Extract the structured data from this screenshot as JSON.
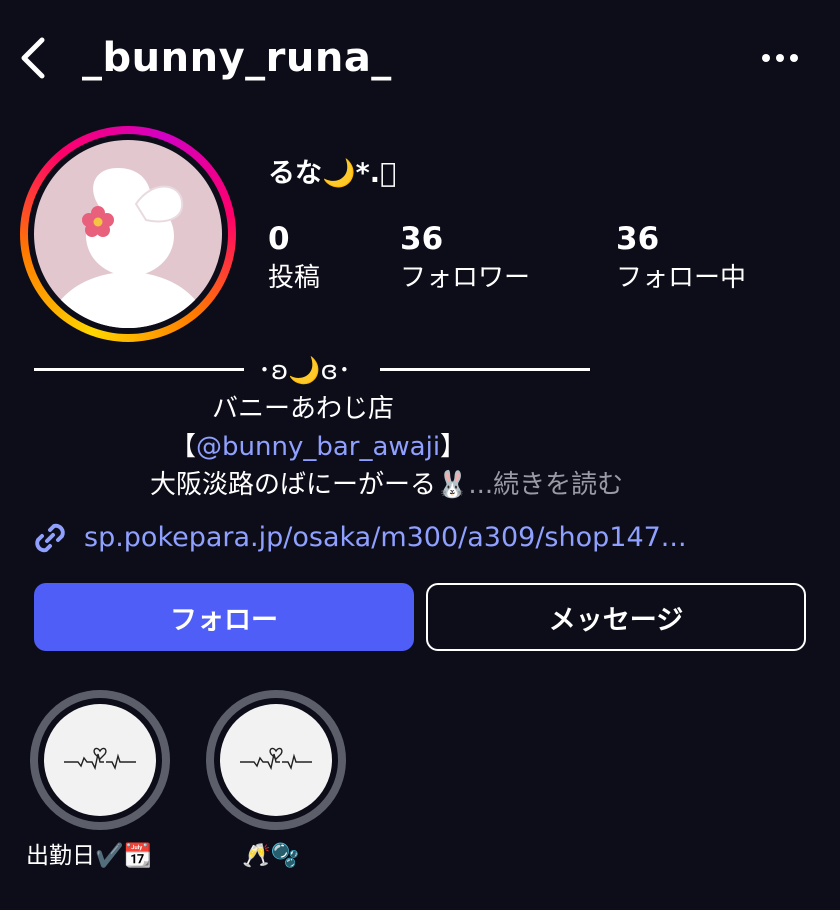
{
  "header": {
    "username": "_bunny_runa_",
    "back_icon": "chevron-left-icon",
    "more_icon": "more-horizontal-icon"
  },
  "profile": {
    "display_name": "るな🌙*.ﾟ",
    "avatar_icon": "bunny-avatar",
    "stats": [
      {
        "value": "0",
        "label": "投稿"
      },
      {
        "value": "36",
        "label": "フォロワー"
      },
      {
        "value": "36",
        "label": "フォロー中"
      }
    ]
  },
  "bio": {
    "divider": "･ʚ🌙ɞ･",
    "line1": "バニーあわじ店",
    "line2_open": "【",
    "mention": "@bunny_bar_awaji",
    "line2_close": "】",
    "line3": "大阪淡路のばにーがーる🐰",
    "ellipsis": "...",
    "more": "続きを読む"
  },
  "link": {
    "icon": "link-icon",
    "text": "sp.pokepara.jp/osaka/m300/a309/shop147..."
  },
  "actions": {
    "follow": "フォロー",
    "message": "メッセージ"
  },
  "highlights": [
    {
      "label": "出勤日✔️📆",
      "icon": "heartbeat-line-icon"
    },
    {
      "label": "🥂🫧",
      "icon": "heartbeat-line-icon"
    }
  ],
  "colors": {
    "background": "#0d0d1a",
    "accent": "#4f5ef7",
    "link": "#8fa0ff"
  }
}
